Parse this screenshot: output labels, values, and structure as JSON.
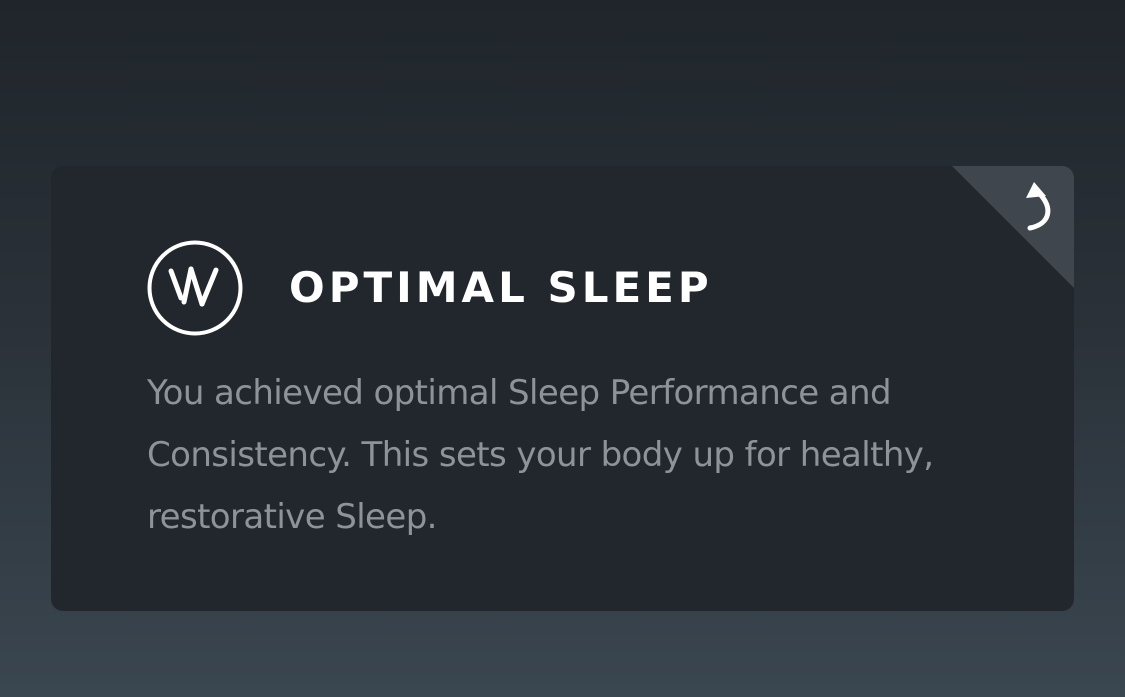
{
  "card": {
    "title": "OPTIMAL SLEEP",
    "body": "You achieved optimal Sleep Performance and Consistency. This sets your body up for healthy, restorative Sleep.",
    "logo_icon": "whoop-logo-icon",
    "flip_icon": "curved-arrow-back-icon"
  },
  "colors": {
    "card_background": "#22272d",
    "title": "#ffffff",
    "body_text": "#8e9399",
    "corner_fold": "#40464d"
  }
}
